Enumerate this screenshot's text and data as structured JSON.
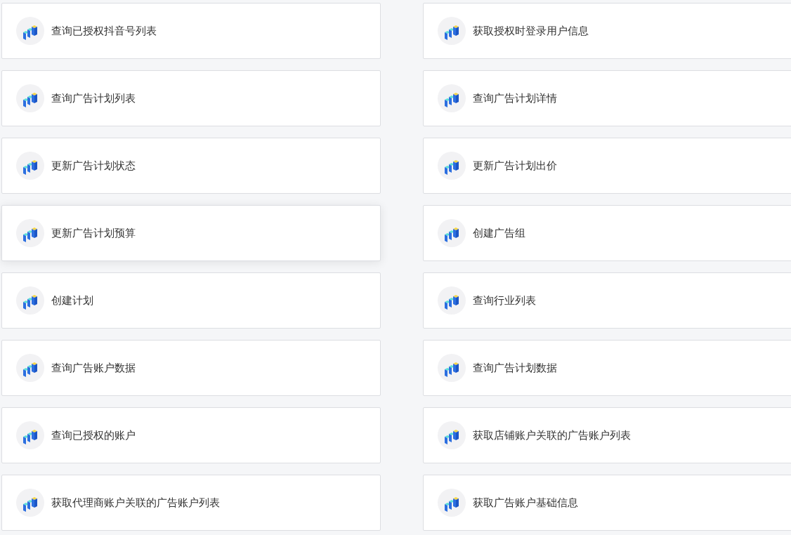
{
  "cards": [
    {
      "label": "查询已授权抖音号列表",
      "hovered": false
    },
    {
      "label": "获取授权时登录用户信息",
      "hovered": false
    },
    {
      "label": "查询广告计划列表",
      "hovered": false
    },
    {
      "label": "查询广告计划详情",
      "hovered": false
    },
    {
      "label": "更新广告计划状态",
      "hovered": false
    },
    {
      "label": "更新广告计划出价",
      "hovered": false
    },
    {
      "label": "更新广告计划预算",
      "hovered": true
    },
    {
      "label": "创建广告组",
      "hovered": false
    },
    {
      "label": "创建计划",
      "hovered": false
    },
    {
      "label": "查询行业列表",
      "hovered": false
    },
    {
      "label": "查询广告账户数据",
      "hovered": false
    },
    {
      "label": "查询广告计划数据",
      "hovered": false
    },
    {
      "label": "查询已授权的账户",
      "hovered": false
    },
    {
      "label": "获取店铺账户关联的广告账户列表",
      "hovered": false
    },
    {
      "label": "获取代理商账户关联的广告账户列表",
      "hovered": false
    },
    {
      "label": "获取广告账户基础信息",
      "hovered": false
    }
  ]
}
